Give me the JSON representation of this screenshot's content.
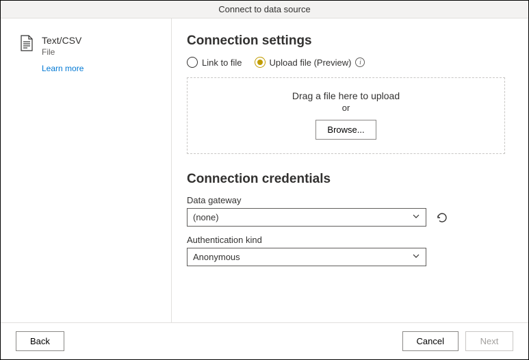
{
  "window": {
    "title": "Connect to data source"
  },
  "sidebar": {
    "connector_name": "Text/CSV",
    "connector_type": "File",
    "learn_more": "Learn more"
  },
  "settings": {
    "heading": "Connection settings",
    "radio_link": "Link to file",
    "radio_upload": "Upload file (Preview)",
    "selected_radio": "upload",
    "drop_text": "Drag a file here to upload",
    "or_text": "or",
    "browse_label": "Browse..."
  },
  "credentials": {
    "heading": "Connection credentials",
    "gateway_label": "Data gateway",
    "gateway_value": "(none)",
    "auth_label": "Authentication kind",
    "auth_value": "Anonymous"
  },
  "footer": {
    "back": "Back",
    "cancel": "Cancel",
    "next": "Next"
  }
}
